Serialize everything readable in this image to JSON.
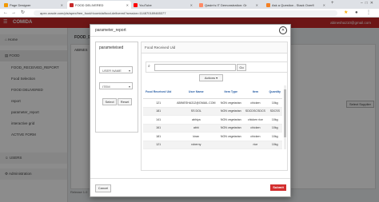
{
  "browser": {
    "tabs": [
      {
        "label": "Page Designer",
        "color": "#f29900",
        "active": false
      },
      {
        "label": "FOOD DELIVERED",
        "color": "#c62828",
        "active": true
      },
      {
        "label": "YouTube",
        "color": "#ff0000",
        "active": false
      },
      {
        "label": "Qasim's IT Demonstration: Gr",
        "color": "#ff8a65",
        "active": false
      },
      {
        "label": "Ask a Question - Stack Overfl",
        "color": "#f48024",
        "active": false
      }
    ],
    "new_tab": "+",
    "url": "apex.oracle.com/pls/apex/free_food/r/comida/food-delivered?session=114870189465377"
  },
  "app": {
    "title": "COMIDA",
    "user": "abinesha210@gmail.com",
    "accent": "#c62828"
  },
  "sidebar": {
    "items": [
      {
        "label": "Home",
        "icon": "home-icon",
        "type": "section"
      },
      {
        "label": "FOOD",
        "icon": "folder-icon",
        "type": "active"
      },
      {
        "label": "FOOD_RECEIVED_REPORT",
        "type": "sub"
      },
      {
        "label": "Food Selection",
        "type": "sub"
      },
      {
        "label": "FOOD DELIVERED",
        "type": "sub"
      },
      {
        "label": "report",
        "type": "sub"
      },
      {
        "label": "parameter_report",
        "type": "sub"
      },
      {
        "label": "interactive grid",
        "type": "sub"
      },
      {
        "label": "ACTIVE FORM",
        "type": "sub"
      },
      {
        "label": "USERS",
        "icon": "users-icon",
        "type": "section"
      },
      {
        "label": "Administration",
        "icon": "wrench-icon",
        "type": "section"
      }
    ]
  },
  "background": {
    "heading": "FOOD_DEL",
    "field_value": "ABINES",
    "select_supplier": "Select Supplier",
    "release": "Release 1.0"
  },
  "dialog": {
    "title": "parameter_report",
    "param_box": {
      "title": "parameteised",
      "user_select": "USER NAME",
      "item_select": "ITEM",
      "select_btn": "Select",
      "reset_btn": "Reset"
    },
    "report": {
      "title": "Food Received Uid",
      "go": "Go",
      "actions": "Actions",
      "columns": [
        "Food Received Uid",
        "User Name",
        "Item Type",
        "Item",
        "Quantity"
      ],
      "rows": [
        [
          "121",
          "ABINESHA312@GMAIL.COM",
          "NON vegetarian",
          "chicken",
          "10kg"
        ],
        [
          "181",
          "SS DOL",
          "NON vegetarian",
          "SDCDSCSDCS",
          "SDCSS"
        ],
        [
          "141",
          "abhiya",
          "NON vegetarian",
          "chicken rice",
          "10kg"
        ],
        [
          "161",
          "abhi",
          "NON vegetarian",
          "chicken",
          "10kg"
        ],
        [
          "181",
          "kiran",
          "NON vegetarian",
          "chicken",
          "10kg"
        ],
        [
          "121",
          "roberny",
          "",
          "rice",
          "10kg"
        ]
      ]
    },
    "cancel": "Cancel",
    "submit": "Submit"
  }
}
